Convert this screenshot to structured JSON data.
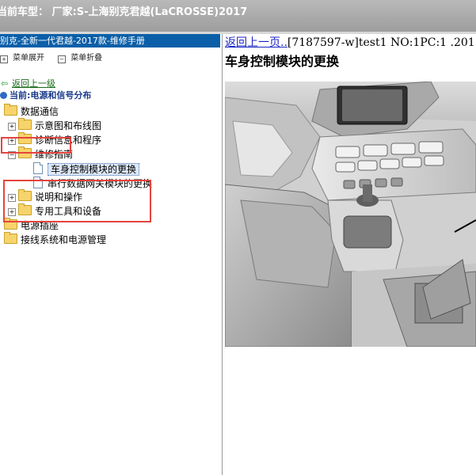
{
  "app": {
    "title": "当前车型：  厂家:S-上海别克君越(LaCROSSE)2017"
  },
  "left_panel": {
    "title": "别克-全新一代君越-2017款-维修手册",
    "toolbar": {
      "expand_label": "菜单展开",
      "collapse_label": "菜单折叠"
    },
    "back_label": "返回上一级",
    "current_label": "当前:电源和信号分布",
    "tree": [
      {
        "label": "数据通信",
        "level": 0
      },
      {
        "label": "示意图和布线图",
        "level": 1
      },
      {
        "label": "诊断信息和程序",
        "level": 1
      },
      {
        "label": "维修指南",
        "level": 1
      },
      {
        "label": "车身控制模块的更换",
        "level": 2,
        "selected": true
      },
      {
        "label": "串行数据网关模块的更换",
        "level": 2
      },
      {
        "label": "说明和操作",
        "level": 1
      },
      {
        "label": "专用工具和设备",
        "level": 1
      },
      {
        "label": "电源插座",
        "level": 0
      },
      {
        "label": "接线系统和电源管理",
        "level": 0
      }
    ]
  },
  "right_panel": {
    "back_link": "返回上一页..",
    "header_text": "[7187597-w]test1 NO:1PC:1 .201",
    "doc_title": "车身控制模块的更换"
  },
  "colors": {
    "title_bar": "#0b5fa8",
    "highlight_box": "#e5443e",
    "link": "#1a24c4"
  }
}
